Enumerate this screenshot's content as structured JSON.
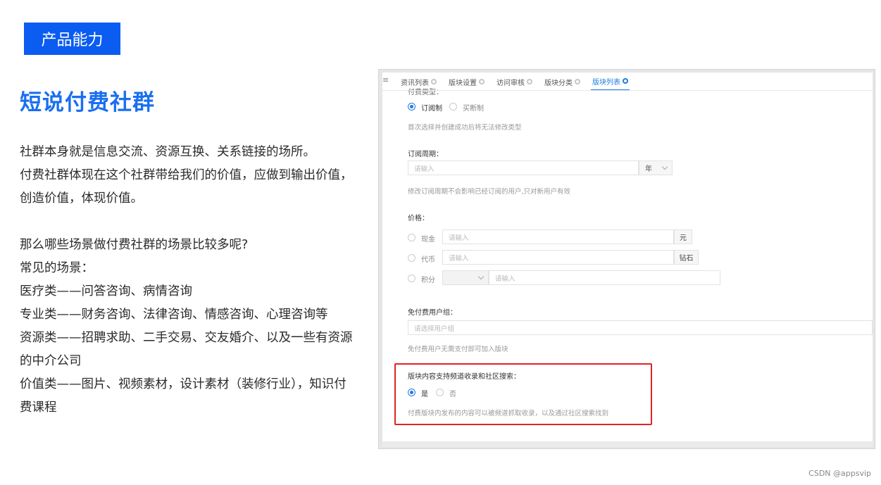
{
  "slide": {
    "tag": "产品能力",
    "title": "短说付费社群",
    "paragraph1": [
      "社群本身就是信息交流、资源互换、关系链接的场所。",
      "付费社群体现在这个社群带给我们的价值，应做到输出价值，",
      "创造价值，体现价值。"
    ],
    "paragraph2": [
      "那么哪些场景做付费社群的场景比较多呢?",
      "常见的场景：",
      "医疗类——问答咨询、病情咨询",
      "专业类——财务咨询、法律咨询、情感咨询、心理咨询等",
      "资源类——招聘求助、二手交易、交友婚介、以及一些有资源",
      "的中介公司",
      "价值类——图片、视频素材，设计素材（装修行业），知识付",
      "费课程"
    ],
    "credit": "CSDN @appsvip"
  },
  "screenshot": {
    "tabs": [
      {
        "label": "资讯列表",
        "active": false
      },
      {
        "label": "版块设置",
        "active": false
      },
      {
        "label": "访问审核",
        "active": false
      },
      {
        "label": "版块分类",
        "active": false
      },
      {
        "label": "版块列表",
        "active": true
      }
    ],
    "pay_type": {
      "label": "付费类型：",
      "options": [
        "订阅制",
        "买断制"
      ],
      "selected": "订阅制",
      "hint": "首次选择并创建成功后将无法修改类型"
    },
    "period": {
      "label": "订阅周期：",
      "placeholder": "请输入",
      "unit": "年",
      "hint": "修改订阅周期不会影响已经订阅的用户,只对新用户有效"
    },
    "price": {
      "label": "价格：",
      "rows": [
        {
          "option": "现金",
          "placeholder": "请输入",
          "addon": "元"
        },
        {
          "option": "代币",
          "placeholder": "请输入",
          "addon": "钻石"
        },
        {
          "option": "积分",
          "select": "",
          "placeholder": "请输入"
        }
      ]
    },
    "free_group": {
      "label": "免付费用户组：",
      "placeholder": "请选择用户组",
      "hint": "免付费用户无需支付即可加入版块"
    },
    "search": {
      "label": "版块内容支持频道收录和社区搜索：",
      "options": [
        "是",
        "否"
      ],
      "selected": "是",
      "hint": "付费版块内发布的内容可以被频道抓取收录，以及通过社区搜索找到"
    },
    "highlight_color": "#e02424",
    "accent_color": "#1f7ae0"
  }
}
